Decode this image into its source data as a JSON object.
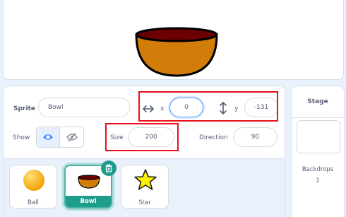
{
  "sprite_info": {
    "sprite_label": "Sprite",
    "sprite_name": "Bowl",
    "x_label": "x",
    "x_value": "0",
    "y_label": "y",
    "y_value": "-131",
    "show_label": "Show",
    "size_label": "Size",
    "size_value": "200",
    "direction_label": "Direction",
    "direction_value": "90"
  },
  "sprites": [
    {
      "name": "Ball",
      "icon": "ball-sprite-icon",
      "selected": false
    },
    {
      "name": "Bowl",
      "icon": "bowl-sprite-icon",
      "selected": true
    },
    {
      "name": "Star",
      "icon": "star-sprite-icon",
      "selected": false
    }
  ],
  "stage_panel": {
    "title": "Stage",
    "backdrops_label": "Backdrops",
    "backdrops_count": "1"
  },
  "colors": {
    "accent": "#4c97ff",
    "selected": "#1f9c8c",
    "highlight": "#e8101a"
  }
}
